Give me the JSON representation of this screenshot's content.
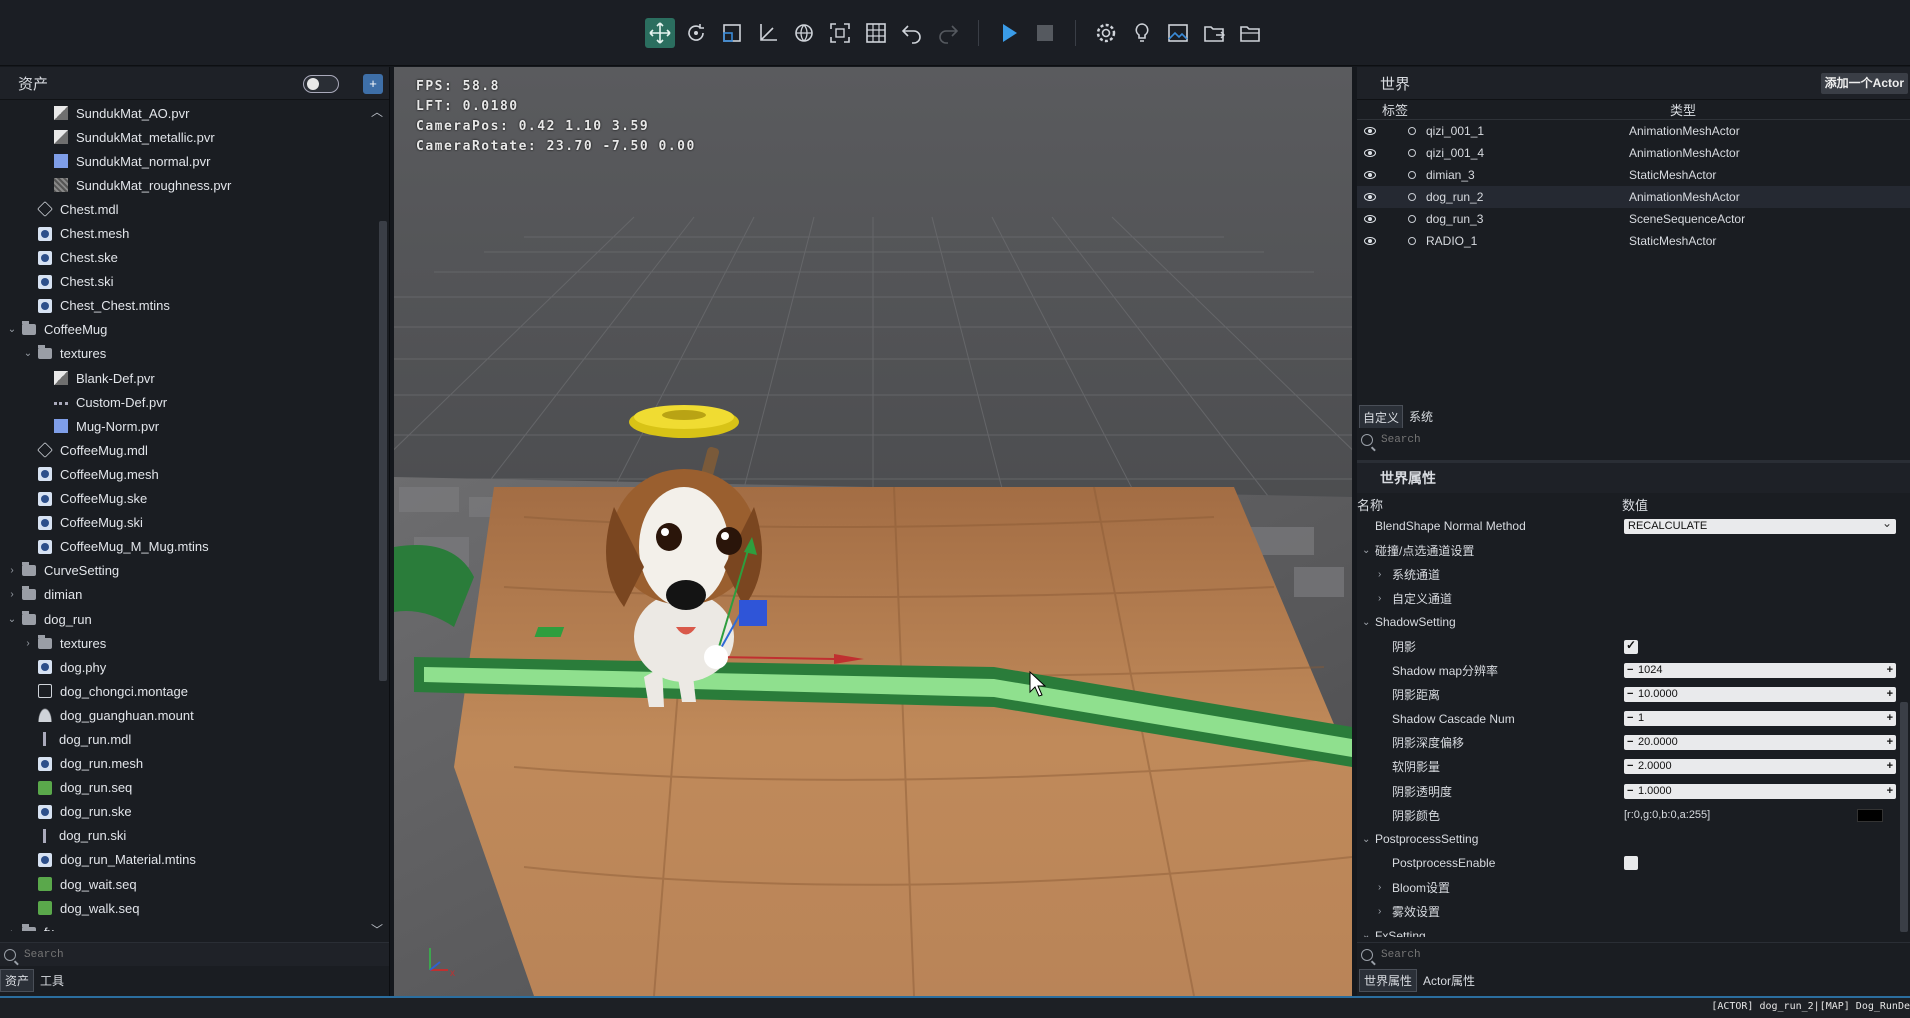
{
  "toolbar": {
    "icons": [
      "move-icon",
      "rotate-icon",
      "scale-icon",
      "transform-axis-icon",
      "globe-icon",
      "focus-icon",
      "grid-icon",
      "undo-icon",
      "redo-icon",
      "play-icon",
      "stop-icon",
      "settings-icon",
      "light-icon",
      "image-icon",
      "folder-export-icon",
      "folder-open-icon"
    ],
    "accent": "#2b6e5f"
  },
  "assets": {
    "title": "资产",
    "search_placeholder": "Search",
    "tabs": [
      "资产",
      "工具"
    ],
    "tree": [
      {
        "label": "SundukMat_AO.pvr",
        "level": 2,
        "icon": "tex",
        "caret": ""
      },
      {
        "label": "SundukMat_metallic.pvr",
        "level": 2,
        "icon": "tex",
        "caret": ""
      },
      {
        "label": "SundukMat_normal.pvr",
        "level": 2,
        "icon": "norm",
        "caret": ""
      },
      {
        "label": "SundukMat_roughness.pvr",
        "level": 2,
        "icon": "rough",
        "caret": ""
      },
      {
        "label": "Chest.mdl",
        "level": 1,
        "icon": "mdl",
        "caret": ""
      },
      {
        "label": "Chest.mesh",
        "level": 1,
        "icon": "file",
        "caret": ""
      },
      {
        "label": "Chest.ske",
        "level": 1,
        "icon": "file",
        "caret": ""
      },
      {
        "label": "Chest.ski",
        "level": 1,
        "icon": "file",
        "caret": ""
      },
      {
        "label": "Chest_Chest.mtins",
        "level": 1,
        "icon": "file",
        "caret": ""
      },
      {
        "label": "CoffeeMug",
        "level": 0,
        "icon": "folder",
        "caret": "⌄"
      },
      {
        "label": "textures",
        "level": 1,
        "icon": "folder",
        "caret": "⌄"
      },
      {
        "label": "Blank-Def.pvr",
        "level": 2,
        "icon": "tex",
        "caret": ""
      },
      {
        "label": "Custom-Def.pvr",
        "level": 2,
        "icon": "dot",
        "caret": ""
      },
      {
        "label": "Mug-Norm.pvr",
        "level": 2,
        "icon": "norm",
        "caret": ""
      },
      {
        "label": "CoffeeMug.mdl",
        "level": 1,
        "icon": "mdl",
        "caret": ""
      },
      {
        "label": "CoffeeMug.mesh",
        "level": 1,
        "icon": "file",
        "caret": ""
      },
      {
        "label": "CoffeeMug.ske",
        "level": 1,
        "icon": "file",
        "caret": ""
      },
      {
        "label": "CoffeeMug.ski",
        "level": 1,
        "icon": "file",
        "caret": ""
      },
      {
        "label": "CoffeeMug_M_Mug.mtins",
        "level": 1,
        "icon": "file",
        "caret": ""
      },
      {
        "label": "CurveSetting",
        "level": 0,
        "icon": "folder",
        "caret": "›"
      },
      {
        "label": "dimian",
        "level": 0,
        "icon": "folder",
        "caret": "›"
      },
      {
        "label": "dog_run",
        "level": 0,
        "icon": "folder",
        "caret": "⌄"
      },
      {
        "label": "textures",
        "level": 1,
        "icon": "folder",
        "caret": "›"
      },
      {
        "label": "dog.phy",
        "level": 1,
        "icon": "file",
        "caret": ""
      },
      {
        "label": "dog_chongci.montage",
        "level": 1,
        "icon": "mont",
        "caret": ""
      },
      {
        "label": "dog_guanghuan.mount",
        "level": 1,
        "icon": "mount",
        "caret": ""
      },
      {
        "label": "dog_run.mdl",
        "level": 1,
        "icon": "thin",
        "caret": ""
      },
      {
        "label": "dog_run.mesh",
        "level": 1,
        "icon": "file",
        "caret": ""
      },
      {
        "label": "dog_run.seq",
        "level": 1,
        "icon": "seq",
        "caret": ""
      },
      {
        "label": "dog_run.ske",
        "level": 1,
        "icon": "file",
        "caret": ""
      },
      {
        "label": "dog_run.ski",
        "level": 1,
        "icon": "thin",
        "caret": ""
      },
      {
        "label": "dog_run_Material.mtins",
        "level": 1,
        "icon": "file",
        "caret": ""
      },
      {
        "label": "dog_wait.seq",
        "level": 1,
        "icon": "seq",
        "caret": ""
      },
      {
        "label": "dog_walk.seq",
        "level": 1,
        "icon": "seq",
        "caret": ""
      },
      {
        "label": "fx",
        "level": 0,
        "icon": "folder",
        "caret": "›"
      }
    ]
  },
  "viewport": {
    "hud": [
      "FPS: 58.8",
      "LFT: 0.0180",
      "CameraPos: 0.42 1.10 3.59",
      "CameraRotate: 23.70 -7.50 0.00"
    ]
  },
  "world": {
    "title": "世界",
    "add_actor": "添加一个Actor",
    "col_label": "标签",
    "col_type": "类型",
    "actors": [
      {
        "name": "qizi_001_1",
        "type": "AnimationMeshActor",
        "selected": false
      },
      {
        "name": "qizi_001_4",
        "type": "AnimationMeshActor",
        "selected": false
      },
      {
        "name": "dimian_3",
        "type": "StaticMeshActor",
        "selected": false
      },
      {
        "name": "dog_run_2",
        "type": "AnimationMeshActor",
        "selected": true
      },
      {
        "name": "dog_run_3",
        "type": "SceneSequenceActor",
        "selected": false
      },
      {
        "name": "RADIO_1",
        "type": "StaticMeshActor",
        "selected": false
      }
    ],
    "tabs": [
      "自定义",
      "系统"
    ],
    "search_placeholder": "Search"
  },
  "props": {
    "title": "世界属性",
    "col_name": "名称",
    "col_value": "数值",
    "rows": [
      {
        "label": "BlendShape Normal Method",
        "level": 0,
        "caret": "",
        "kind": "dropdown",
        "value": "RECALCULATE"
      },
      {
        "label": "碰撞/点选通道设置",
        "level": 0,
        "caret": "⌄",
        "kind": "none",
        "value": ""
      },
      {
        "label": "系统通道",
        "level": 1,
        "caret": "›",
        "kind": "none",
        "value": ""
      },
      {
        "label": "自定义通道",
        "level": 1,
        "caret": "›",
        "kind": "none",
        "value": ""
      },
      {
        "label": "ShadowSetting",
        "level": 0,
        "caret": "⌄",
        "kind": "none",
        "value": ""
      },
      {
        "label": "阴影",
        "level": 1,
        "caret": "",
        "kind": "check-on",
        "value": ""
      },
      {
        "label": "Shadow map分辨率",
        "level": 1,
        "caret": "",
        "kind": "number",
        "value": "1024"
      },
      {
        "label": "阴影距离",
        "level": 1,
        "caret": "",
        "kind": "number",
        "value": "10.0000"
      },
      {
        "label": "Shadow Cascade Num",
        "level": 1,
        "caret": "",
        "kind": "number",
        "value": "1"
      },
      {
        "label": "阴影深度偏移",
        "level": 1,
        "caret": "",
        "kind": "number",
        "value": "20.0000"
      },
      {
        "label": "软阴影量",
        "level": 1,
        "caret": "",
        "kind": "number",
        "value": "2.0000"
      },
      {
        "label": "阴影透明度",
        "level": 1,
        "caret": "",
        "kind": "number",
        "value": "1.0000"
      },
      {
        "label": "阴影颜色",
        "level": 1,
        "caret": "",
        "kind": "color",
        "value": "[r:0,g:0,b:0,a:255]"
      },
      {
        "label": "PostprocessSetting",
        "level": 0,
        "caret": "⌄",
        "kind": "none",
        "value": ""
      },
      {
        "label": "PostprocessEnable",
        "level": 1,
        "caret": "",
        "kind": "check-off",
        "value": ""
      },
      {
        "label": "Bloom设置",
        "level": 1,
        "caret": "›",
        "kind": "none",
        "value": ""
      },
      {
        "label": "雾效设置",
        "level": 1,
        "caret": "›",
        "kind": "none",
        "value": ""
      },
      {
        "label": "FxSetting",
        "level": 0,
        "caret": "⌄",
        "kind": "none",
        "value": ""
      }
    ],
    "search_placeholder": "Search",
    "tabs": [
      "世界属性",
      "Actor属性"
    ]
  },
  "status": {
    "text": "[ACTOR] dog_run_2|[MAP] Dog_RunDe"
  }
}
